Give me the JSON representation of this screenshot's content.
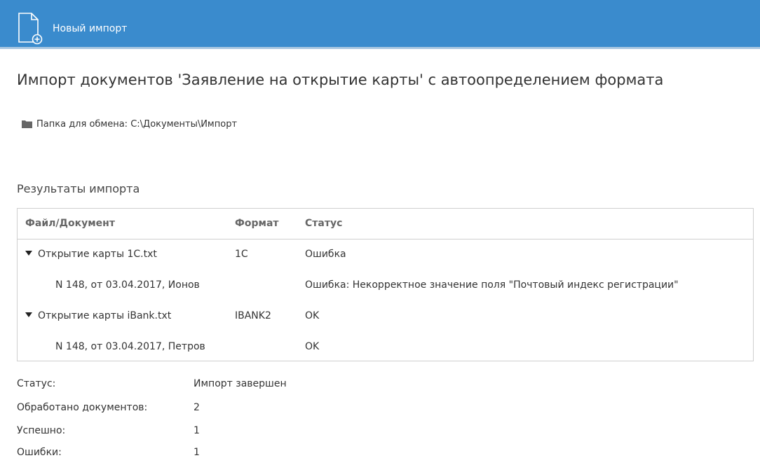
{
  "header": {
    "title": "Новый импорт",
    "icon": "new-document-icon",
    "background": "#3a8bcd"
  },
  "page_title": "Импорт документов 'Заявление на открытие карты' с автоопределением формата",
  "folder": {
    "icon": "folder-icon",
    "label": "Папка для обмена: C:\\Документы\\Импорт"
  },
  "results": {
    "title": "Результаты импорта",
    "columns": [
      "Файл/Документ",
      "Формат",
      "Статус"
    ],
    "rows": [
      {
        "type": "file",
        "file": "Открытие карты 1C.txt",
        "format": "1C",
        "status": "Ошибка"
      },
      {
        "type": "document",
        "file": "N 148, от 03.04.2017, Ионов",
        "format": "",
        "status": "Ошибка: Некорректное значение поля \"Почтовый индекс регистрации\""
      },
      {
        "type": "file",
        "file": "Открытие карты iBank.txt",
        "format": "IBANK2",
        "status": "OK"
      },
      {
        "type": "document",
        "file": "N 148, от 03.04.2017, Петров",
        "format": "",
        "status": "OK"
      }
    ]
  },
  "summary": [
    {
      "label": "Статус:",
      "value": "Импорт завершен"
    },
    {
      "label": "Обработано документов:",
      "value": "2"
    },
    {
      "label": "Успешно:",
      "value": "1"
    },
    {
      "label": "Ошибки:",
      "value": "1"
    }
  ]
}
